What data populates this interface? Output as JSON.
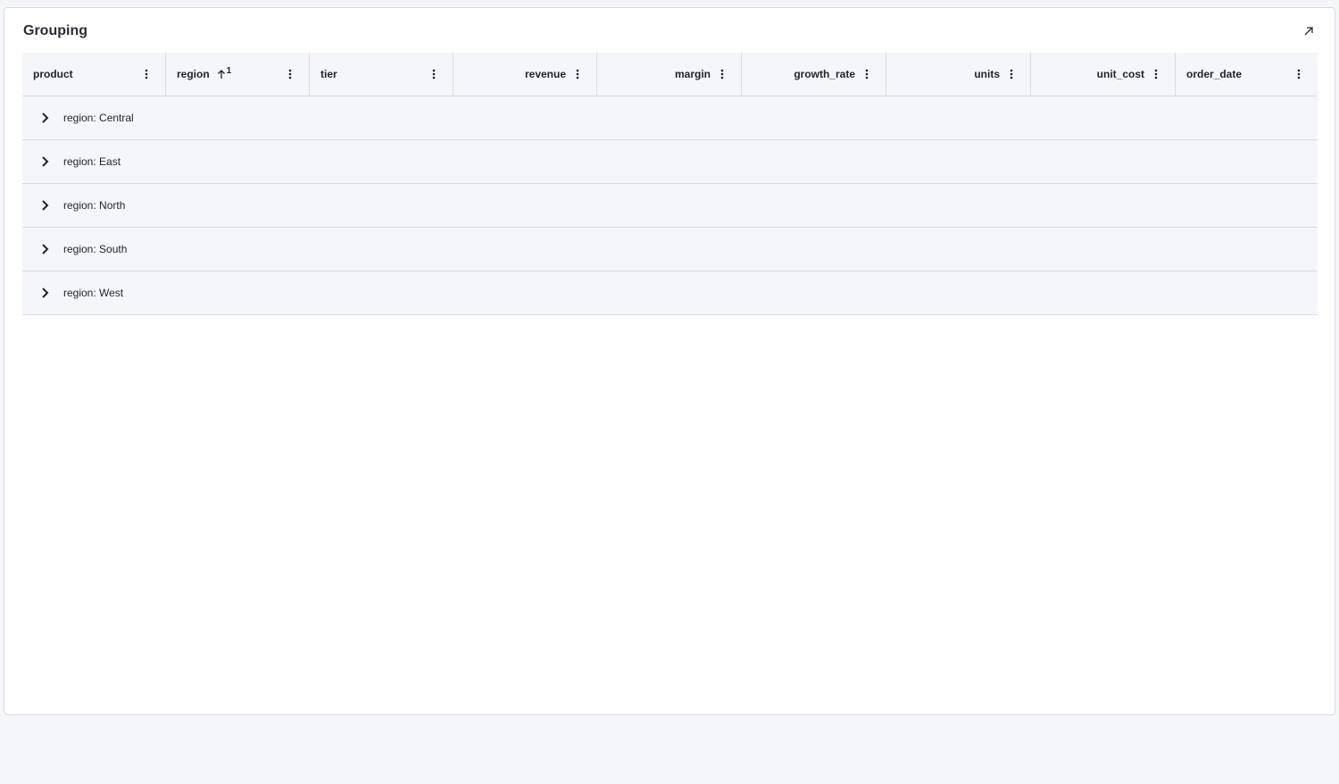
{
  "panel": {
    "title": "Grouping",
    "expand_icon": "expand-arrow-icon"
  },
  "columns": [
    {
      "key": "product",
      "label": "product",
      "align": "left"
    },
    {
      "key": "region",
      "label": "region",
      "align": "left",
      "sort": "asc",
      "sort_order": "1"
    },
    {
      "key": "tier",
      "label": "tier",
      "align": "left"
    },
    {
      "key": "revenue",
      "label": "revenue",
      "align": "right"
    },
    {
      "key": "margin",
      "label": "margin",
      "align": "right"
    },
    {
      "key": "growth_rate",
      "label": "growth_rate",
      "align": "right"
    },
    {
      "key": "units",
      "label": "units",
      "align": "right"
    },
    {
      "key": "unit_cost",
      "label": "unit_cost",
      "align": "right"
    },
    {
      "key": "order_date",
      "label": "order_date",
      "align": "left"
    }
  ],
  "groups": [
    {
      "label": "region: Central",
      "expanded": false
    },
    {
      "label": "region: East",
      "expanded": false
    },
    {
      "label": "region: North",
      "expanded": false
    },
    {
      "label": "region: South",
      "expanded": false
    },
    {
      "label": "region: West",
      "expanded": false
    }
  ]
}
